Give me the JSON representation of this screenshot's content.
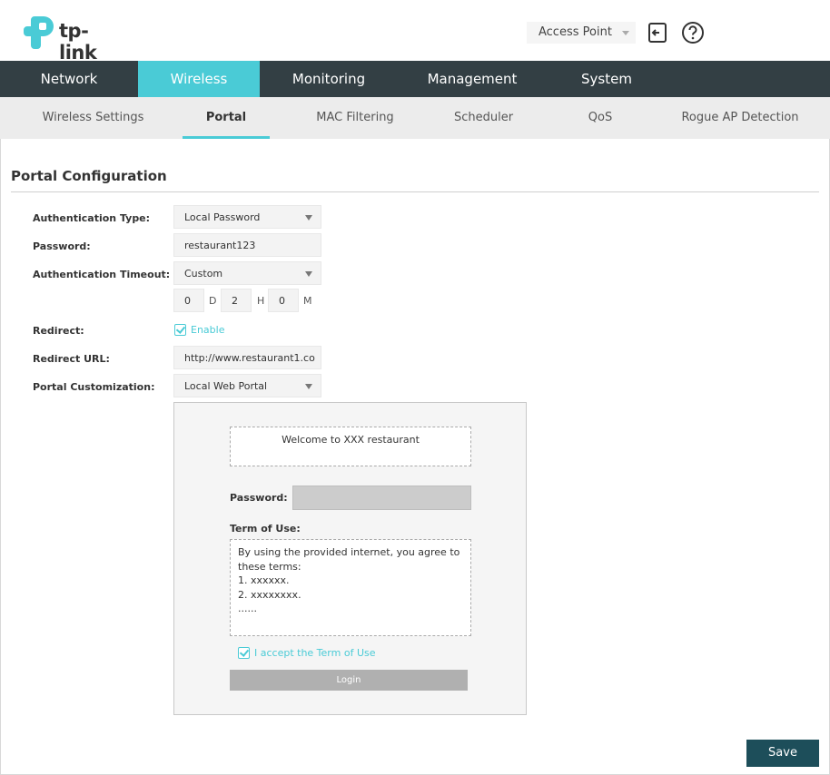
{
  "header": {
    "brand": "tp-link",
    "mode_select": "Access Point"
  },
  "main_nav": [
    {
      "label": "Network"
    },
    {
      "label": "Wireless"
    },
    {
      "label": "Monitoring"
    },
    {
      "label": "Management"
    },
    {
      "label": "System"
    }
  ],
  "sub_nav": [
    {
      "label": "Wireless Settings"
    },
    {
      "label": "Portal"
    },
    {
      "label": "MAC Filtering"
    },
    {
      "label": "Scheduler"
    },
    {
      "label": "QoS"
    },
    {
      "label": "Rogue AP Detection"
    }
  ],
  "section": {
    "title": "Portal Configuration"
  },
  "form": {
    "auth_type": {
      "label": "Authentication Type:",
      "value": "Local Password"
    },
    "password": {
      "label": "Password:",
      "value": "restaurant123"
    },
    "auth_timeout": {
      "label": "Authentication Timeout:",
      "value": "Custom",
      "days": "0",
      "days_unit": "D",
      "hours": "2",
      "hours_unit": "H",
      "minutes": "0",
      "minutes_unit": "M"
    },
    "redirect": {
      "label": "Redirect:",
      "checkbox_label": "Enable"
    },
    "redirect_url": {
      "label": "Redirect URL:",
      "value": "http://www.restaurant1.co"
    },
    "portal_customization": {
      "label": "Portal Customization:",
      "value": "Local Web Portal"
    }
  },
  "preview": {
    "welcome": "Welcome to XXX restaurant",
    "password_label": "Password:",
    "terms_label": "Term of Use:",
    "terms_lines": [
      "By using the provided internet, you agree to",
      "these terms:",
      "1. xxxxxx.",
      "2. xxxxxxxx.",
      "......"
    ],
    "accept_label": "I accept the Term of Use",
    "login_button": "Login"
  },
  "footer": {
    "save_button": "Save"
  },
  "colors": {
    "accent": "#4acbd6",
    "nav_bg": "#333f44",
    "save_bg": "#1d4e5a"
  }
}
